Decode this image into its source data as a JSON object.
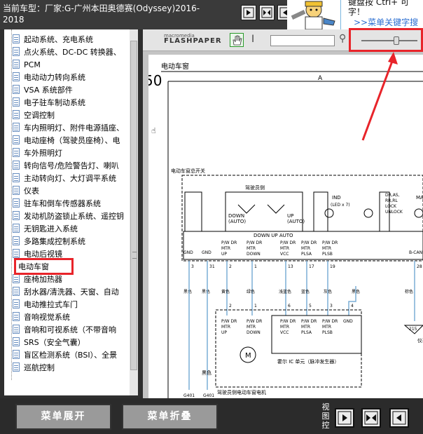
{
  "header": {
    "title": "当前车型：厂家:G-广州本田奥德赛(Odyssey)2016-2018",
    "tip_line1": "键盘按  Ctrl+  可",
    "tip_line2": "字！",
    "tip_link": ">>菜单关键字搜"
  },
  "sidebar": {
    "items": [
      {
        "label": "起动系统、充电系统"
      },
      {
        "label": "点火系统、DC-DC 转换器、"
      },
      {
        "label": "PCM"
      },
      {
        "label": "电动动力转向系统"
      },
      {
        "label": "VSA 系统部件"
      },
      {
        "label": "电子驻车制动系统"
      },
      {
        "label": "空调控制"
      },
      {
        "label": "车内照明灯、附件电源插座、"
      },
      {
        "label": "电动座椅（驾驶员座椅）、电"
      },
      {
        "label": "车外照明灯"
      },
      {
        "label": "转向信号/危险警告灯、喇叭"
      },
      {
        "label": "主动转向灯、大灯调平系统"
      },
      {
        "label": "仪表"
      },
      {
        "label": "驻车和倒车传感器系统"
      },
      {
        "label": "发动机防盗锁止系统、遥控钥"
      },
      {
        "label": "无钥匙进入系统"
      },
      {
        "label": "多路集成控制系统"
      },
      {
        "label": "电动后视镜"
      },
      {
        "label": "电动车窗"
      },
      {
        "label": "座椅加热器"
      },
      {
        "label": "刮水器/清洗器、天窗、自动"
      },
      {
        "label": "电动推拉式车门"
      },
      {
        "label": "音响视觉系统"
      },
      {
        "label": "音响和可视系统（不带音响"
      },
      {
        "label": "SRS（安全气囊）"
      },
      {
        "label": "盲区检测系统（BSI）、全景"
      },
      {
        "label": "巡航控制"
      }
    ],
    "selected_index": 18
  },
  "viewer": {
    "logo_top": "macromedia",
    "logo_main": "FLASHPAPER",
    "zoom_fraction": 0.62
  },
  "diagram": {
    "page_fragment": "50",
    "page_heading": "电动车窗",
    "column_letter": "A",
    "switch_label": "电动车窗总开关",
    "relay_label": "驾驶员侧",
    "down_auto": "DOWN\n(AUTO)",
    "up_auto": "UP\n(AUTO)",
    "ind": "IND",
    "led": "(LED x 7)",
    "lock_group": "DR,AS,\nRR,RL\nLOCK\nUNLOCK",
    "ma": "MA",
    "switch_bar": "DOWN  UP  AUTO",
    "pins": [
      {
        "label": "GND",
        "num": "3"
      },
      {
        "label": "GND",
        "num": "31"
      },
      {
        "label": "P/W DR\nMTR\nUP",
        "num": "2"
      },
      {
        "label": "P/W DR\nMTR\nDOWN",
        "num": "1"
      },
      {
        "label": "P/W DR\nMTR\nVCC",
        "num": "13"
      },
      {
        "label": "P/W DR\nMTR\nPLSA",
        "num": "17"
      },
      {
        "label": "P/W DR\nMTR\nPLSB",
        "num": "19"
      },
      {
        "label": "B-CAN",
        "num": "28"
      }
    ],
    "wire_colors": [
      "黑色",
      "黑色",
      "黄色",
      "绿色",
      "浅蓝色",
      "蓝色",
      "灰色",
      "黑色",
      "棕色"
    ],
    "motor_pins": [
      "2",
      "1",
      "6",
      "5",
      "3",
      "4"
    ],
    "motor_labels": [
      "P/W DR\nMTR\nUP",
      "P/W DR\nMTR\nDOWN",
      "P/W DR\nMTR\nVCC",
      "P/W DR\nMTR\nPLSA",
      "P/W DR\nMTR\nPLSB",
      "GND"
    ],
    "hall_ic": "霍尔 IC 单元（脉冲发生器）",
    "motor_title": "驾驶员侧电动车窗电机",
    "ground_color": "黑色",
    "grounds": [
      "G401",
      "G401"
    ],
    "connector_num": "215",
    "right_frag": "仪表"
  },
  "footer": {
    "expand_label": "菜单展开",
    "collapse_label": "菜单折叠",
    "view_label": "视图控"
  }
}
